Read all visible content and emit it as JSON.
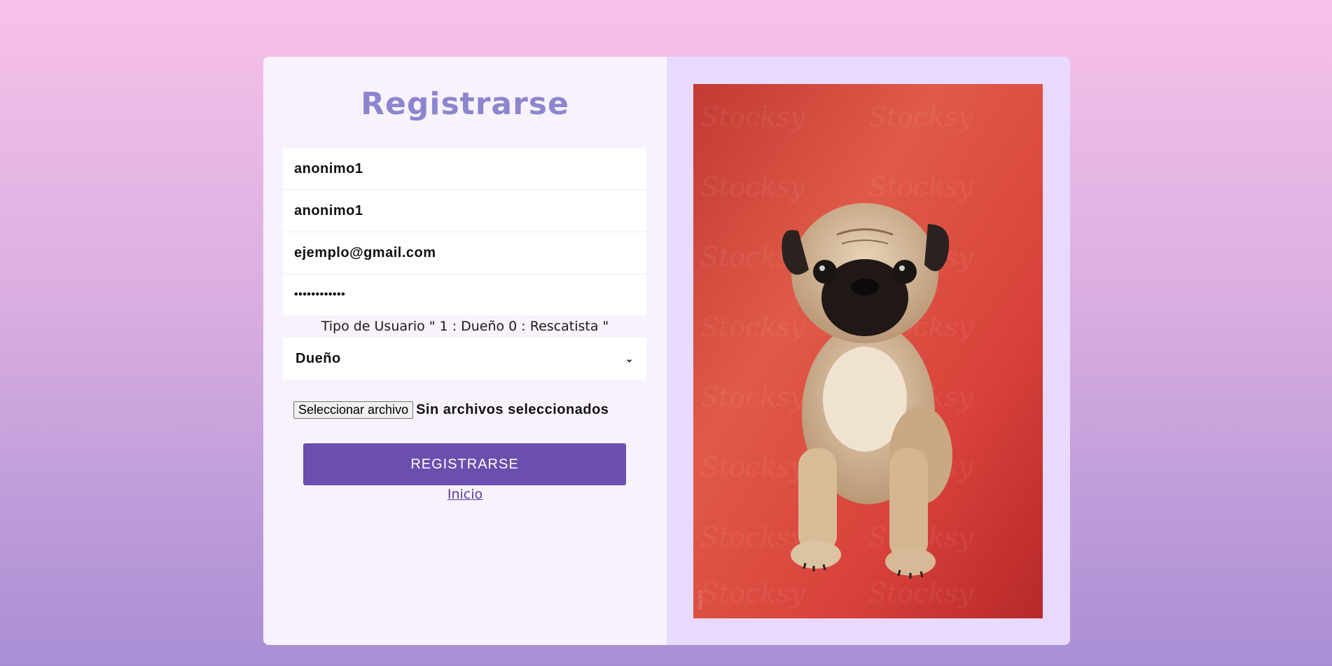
{
  "form": {
    "title": "Registrarse",
    "fields": [
      {
        "value": "anonimo1",
        "type": "text"
      },
      {
        "value": "anonimo1",
        "type": "text"
      },
      {
        "value": "ejemplo@gmail.com",
        "type": "email"
      },
      {
        "value": "••••••••••••",
        "type": "password"
      }
    ],
    "user_type_label": "Tipo de Usuario \" 1 : Dueño 0 : Rescatista \"",
    "user_type_selected": "Dueño",
    "file_button_label": "Seleccionar archivo",
    "file_status": "Sin archivos seleccionados",
    "submit_label": "REGISTRARSE",
    "home_link": "Inicio"
  },
  "image": {
    "subject": "pug puppy sitting on red background",
    "watermark": "Stocksy"
  },
  "colors": {
    "title": "#8c86cf",
    "button": "#6a4fae",
    "form_bg": "#f8f2fd",
    "image_panel_bg": "#e8daff",
    "photo_bg": "#d9453a"
  }
}
